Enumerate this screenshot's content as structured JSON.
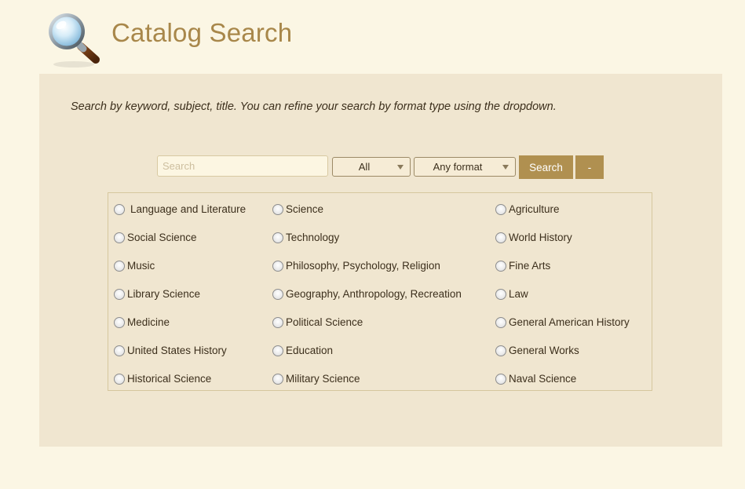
{
  "header": {
    "title": "Catalog Search",
    "logo_icon": "magnifying-glass-icon"
  },
  "panel": {
    "instructions": "Search by keyword, subject, title. You can refine your search by format type using the dropdown."
  },
  "search": {
    "placeholder": "Search",
    "value": "",
    "scope_selected": "All",
    "format_selected": "Any format",
    "search_button": "Search",
    "collapse_button": "-"
  },
  "subjects": {
    "col1": [
      "Language and Literature",
      "Social Science",
      "Music",
      "Library Science",
      "Medicine",
      "United States History",
      "Historical Science"
    ],
    "col2": [
      "Science",
      "Technology",
      "Philosophy, Psychology, Religion",
      "Geography, Anthropology, Recreation",
      "Political Science",
      "Education",
      "Military Science"
    ],
    "col3": [
      "Agriculture",
      "World History",
      "Fine Arts",
      "Law",
      "General American History",
      "General Works",
      "Naval Science"
    ]
  },
  "colors": {
    "background": "#fbf6e4",
    "panel": "#f0e6d0",
    "accent": "#b09050",
    "title": "#a8874a"
  }
}
